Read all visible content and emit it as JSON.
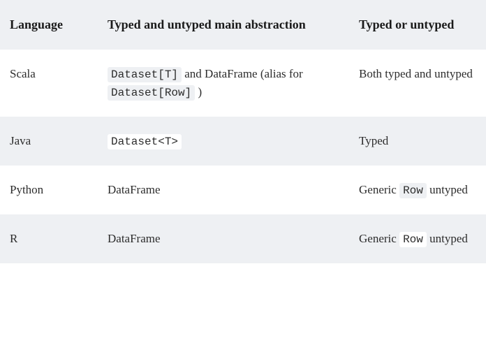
{
  "headers": {
    "language": "Language",
    "abstraction": "Typed and untyped main abstraction",
    "typed": "Typed or untyped"
  },
  "rows": {
    "scala": {
      "lang": "Scala",
      "code1": "Dataset[T]",
      "text1": " and DataFrame (alias for ",
      "code2": "Dataset[Row]",
      "text2": " )",
      "typed": "Both typed and untyped"
    },
    "java": {
      "lang": "Java",
      "code1": "Dataset<T>",
      "typed": "Typed"
    },
    "python": {
      "lang": "Python",
      "abstr": "DataFrame",
      "typed_pre": "Generic ",
      "typed_code": "Row",
      "typed_post": " untyped"
    },
    "r": {
      "lang": "R",
      "abstr": "DataFrame",
      "typed_pre": "Generic ",
      "typed_code": "Row",
      "typed_post": " untyped"
    }
  }
}
